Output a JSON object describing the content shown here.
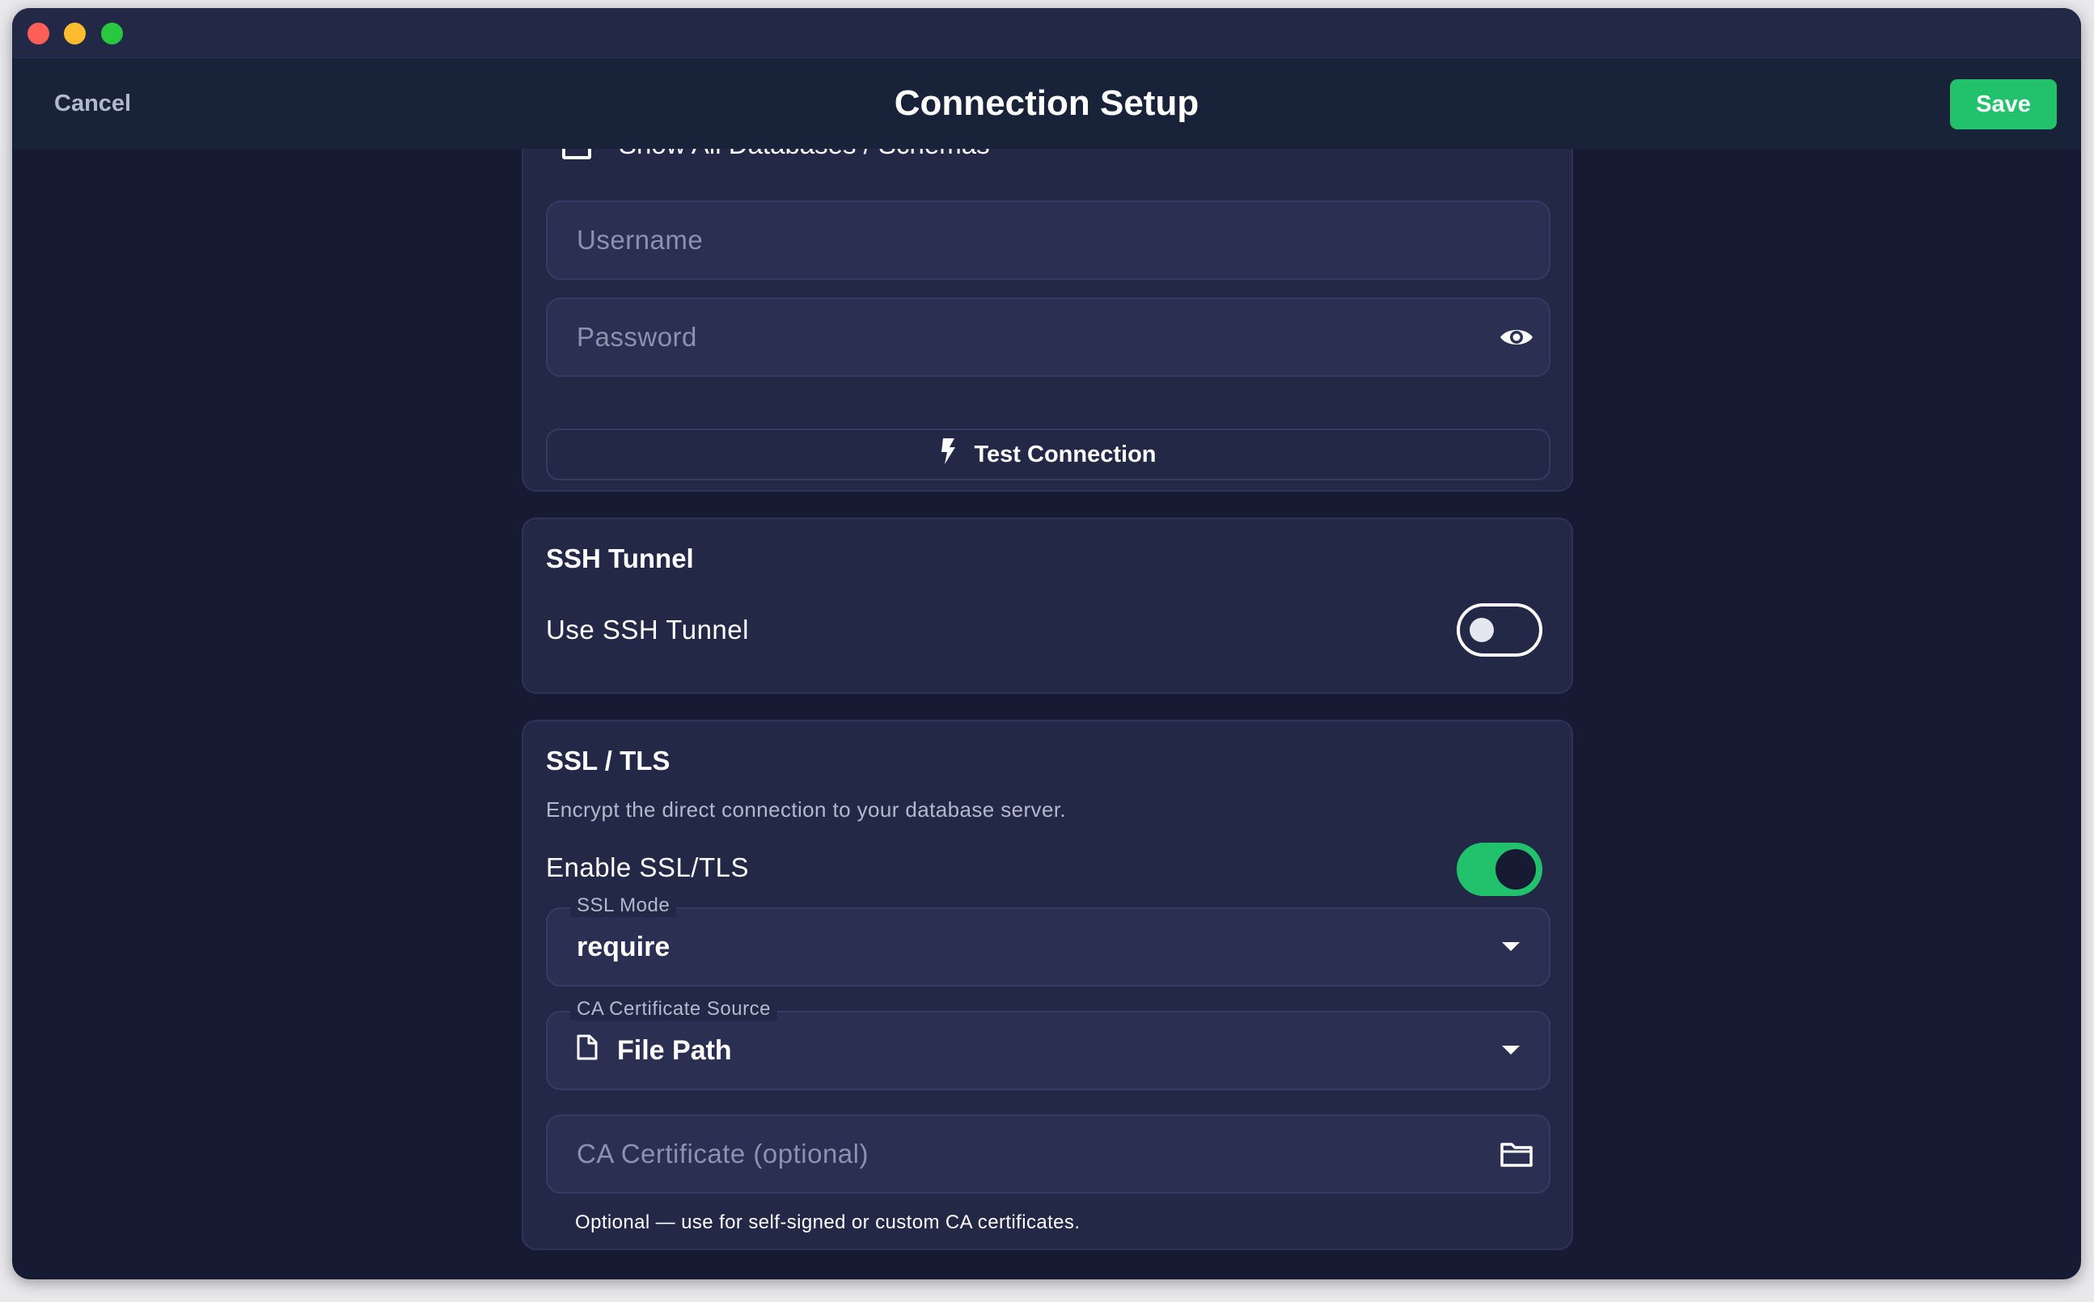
{
  "header": {
    "cancel_label": "Cancel",
    "title": "Connection Setup",
    "save_label": "Save"
  },
  "connection": {
    "show_all_label": "Show All Databases / Schemas",
    "show_all_checked": false,
    "username_placeholder": "Username",
    "password_placeholder": "Password",
    "test_button_label": "Test Connection"
  },
  "ssh": {
    "title": "SSH Tunnel",
    "toggle_label": "Use SSH Tunnel",
    "enabled": false
  },
  "ssl": {
    "title": "SSL / TLS",
    "description": "Encrypt the direct connection to your database server.",
    "toggle_label": "Enable SSL/TLS",
    "enabled": true,
    "mode_label": "SSL Mode",
    "mode_value": "require",
    "ca_source_label": "CA Certificate Source",
    "ca_source_value": "File Path",
    "ca_cert_placeholder": "CA Certificate (optional)",
    "ca_cert_helper": "Optional — use for self-signed or custom CA certificates."
  },
  "colors": {
    "accent": "#22c16b",
    "background": "#161a33",
    "card": "#242847",
    "field": "#2b2f52"
  },
  "icons": {
    "password_toggle": "eye-icon",
    "test": "bolt-icon",
    "file": "file-icon",
    "browse": "folder-icon"
  }
}
